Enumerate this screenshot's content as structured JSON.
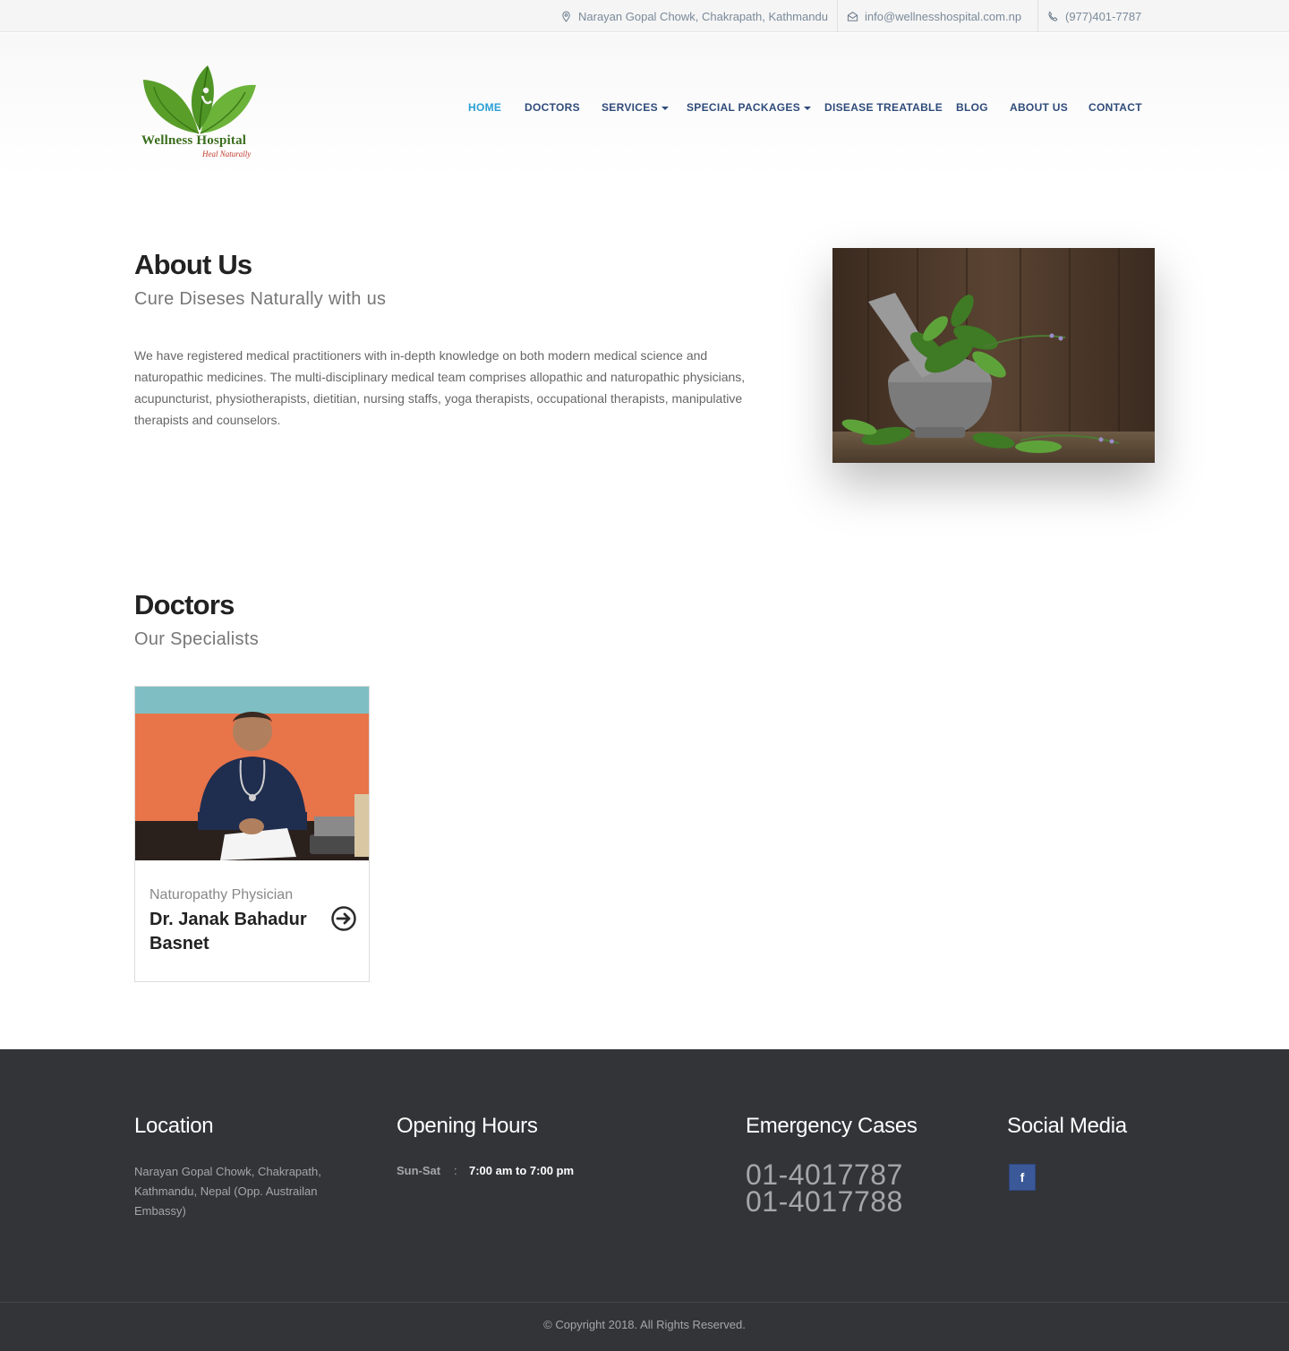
{
  "topbar": {
    "address": "Narayan Gopal Chowk, Chakrapath, Kathmandu",
    "email": "info@wellnesshospital.com.np",
    "phone": "(977)401-7787"
  },
  "logo": {
    "name": "Wellness Hospital",
    "tagline": "Heal Naturally"
  },
  "nav": {
    "items": [
      {
        "label": "HOME",
        "active": true
      },
      {
        "label": "DOCTORS"
      },
      {
        "label": "SERVICES",
        "dropdown": true
      },
      {
        "label": "SPECIAL PACKAGES",
        "dropdown": true
      },
      {
        "label": "DISEASE TREATABLE"
      },
      {
        "label": "BLOG"
      },
      {
        "label": "ABOUT US"
      },
      {
        "label": "CONTACT"
      }
    ]
  },
  "about": {
    "title": "About Us",
    "subtitle": "Cure Diseses Naturally with us",
    "text": "We have registered medical practitioners with in-depth knowledge on both modern medical science and naturopathic medicines. The multi-disciplinary medical team comprises allopathic and naturopathic physicians, acupuncturist, physiotherapists, dietitian, nursing staffs, yoga therapists, occupational therapists, manipulative therapists and counselors."
  },
  "doctors": {
    "title": "Doctors",
    "subtitle": "Our Specialists",
    "items": [
      {
        "role": "Naturopathy Physician",
        "name": "Dr. Janak Bahadur Basnet"
      }
    ]
  },
  "footer": {
    "location_title": "Location",
    "location_text": "Narayan Gopal Chowk, Chakrapath, Kathmandu, Nepal (Opp. Austrailan Embassy)",
    "hours_title": "Opening Hours",
    "hours_day": "Sun-Sat",
    "hours_sep": ":",
    "hours_time": "7:00 am to 7:00 pm",
    "emergency_title": "Emergency Cases",
    "emergency_phones": [
      "01-4017787",
      "01-4017788"
    ],
    "social_title": "Social Media",
    "social_facebook": "f",
    "copyright": "© Copyright 2018. All Rights Reserved."
  },
  "colors": {
    "nav": "#2f4b7a",
    "nav_active": "#2a9fd6",
    "footer_bg": "#333438",
    "facebook": "#3b5998"
  }
}
